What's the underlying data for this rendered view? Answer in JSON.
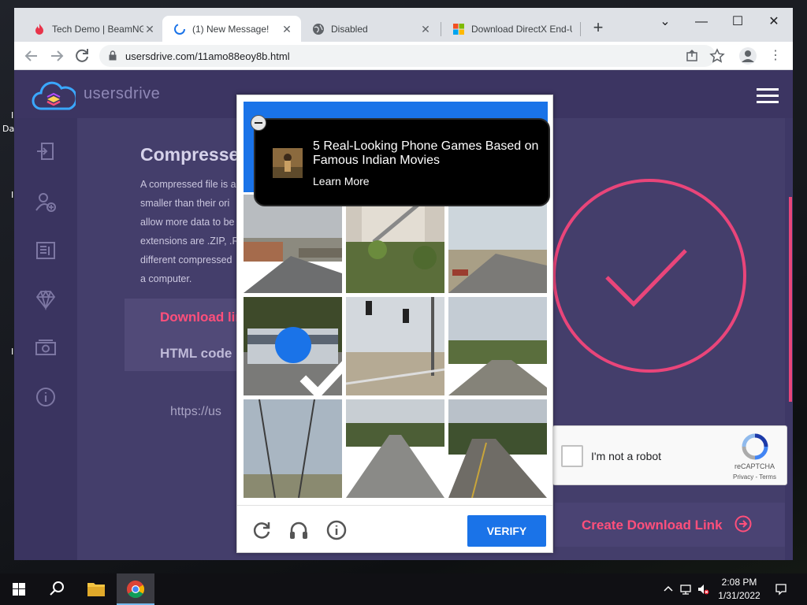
{
  "desktop": {
    "frag_1": "I",
    "frag_2": "Da",
    "frag_3": "I",
    "frag_4": "I"
  },
  "browser": {
    "tabs": [
      {
        "title": "Tech Demo | BeamNG",
        "favicon": "flame-icon",
        "active": false
      },
      {
        "title": "(1) New Message!",
        "favicon": "loading-icon",
        "active": true
      },
      {
        "title": "Disabled",
        "favicon": "globe-icon",
        "active": false
      },
      {
        "title": "Download DirectX End-User",
        "favicon": "microsoft-icon",
        "active": false
      }
    ],
    "new_tab": "+",
    "window_controls": {
      "dropdown": "⌄",
      "minimize": "—",
      "maximize": "☐",
      "close": "✕"
    },
    "url": "usersdrive.com/11amo88eoy8b.html"
  },
  "site": {
    "name": "usersdrive",
    "article": {
      "title": "Compressed",
      "body_lines": [
        "A compressed file is a",
        "smaller than their ori",
        "allow more data to be",
        "extensions are .ZIP, .R",
        "different compressed",
        "a computer."
      ]
    },
    "tabs": {
      "download": "Download link",
      "html": "HTML code"
    },
    "link_text": "https://us",
    "create_button": "Create Download Link",
    "accent_color": "#ff4f7b"
  },
  "recaptcha": {
    "label": "I'm not a robot",
    "brand": "reCAPTCHA",
    "links": "Privacy - Terms"
  },
  "challenge": {
    "verify": "VERIFY",
    "selected_tile": 3,
    "footer_icons": [
      "reload-icon",
      "audio-icon",
      "info-icon"
    ]
  },
  "ad": {
    "headline": "5 Real-Looking Phone Games Based on Famous Indian Movies",
    "cta": "Learn More"
  },
  "taskbar": {
    "time": "2:08 PM",
    "date": "1/31/2022"
  }
}
